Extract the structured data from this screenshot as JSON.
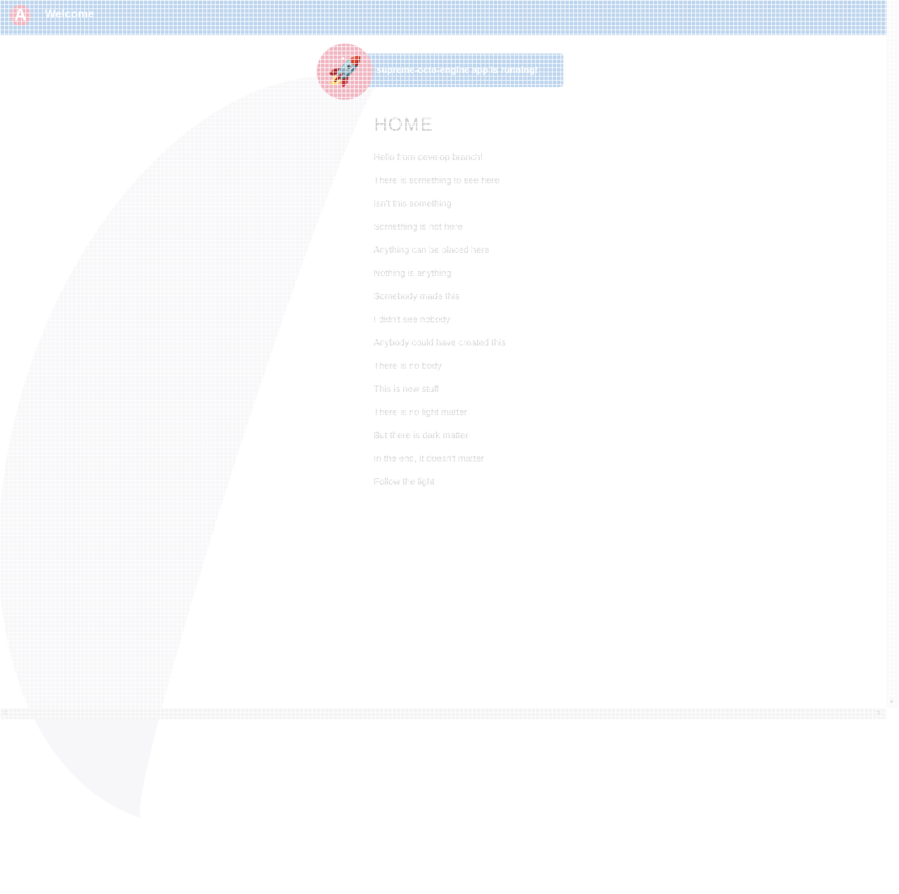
{
  "header": {
    "title": "Welcome",
    "logo_letter": "A"
  },
  "banner": {
    "text": "supreme-octo-engine app is running!",
    "icon": "rocket-icon"
  },
  "main": {
    "title": "HOME",
    "lines": [
      "Hello from develop branch!",
      "There is something to see here",
      "Isn't this something",
      "Something is not here",
      "Anything can be placed here",
      "Nothing is anything",
      "Somebody made this",
      "I didn't see nobody",
      "Anybody could have created this",
      "There is no body",
      "This is new stuff",
      "There is no light matter",
      "But there is dark matter",
      "In the end, it doesn't matter",
      "Follow the light"
    ]
  },
  "colors": {
    "header": "#bcd4ee",
    "accent": "#f0b4c0"
  },
  "scrollbar": {
    "left_arrow": "<",
    "right_arrow": ">",
    "down_arrow": "v"
  }
}
